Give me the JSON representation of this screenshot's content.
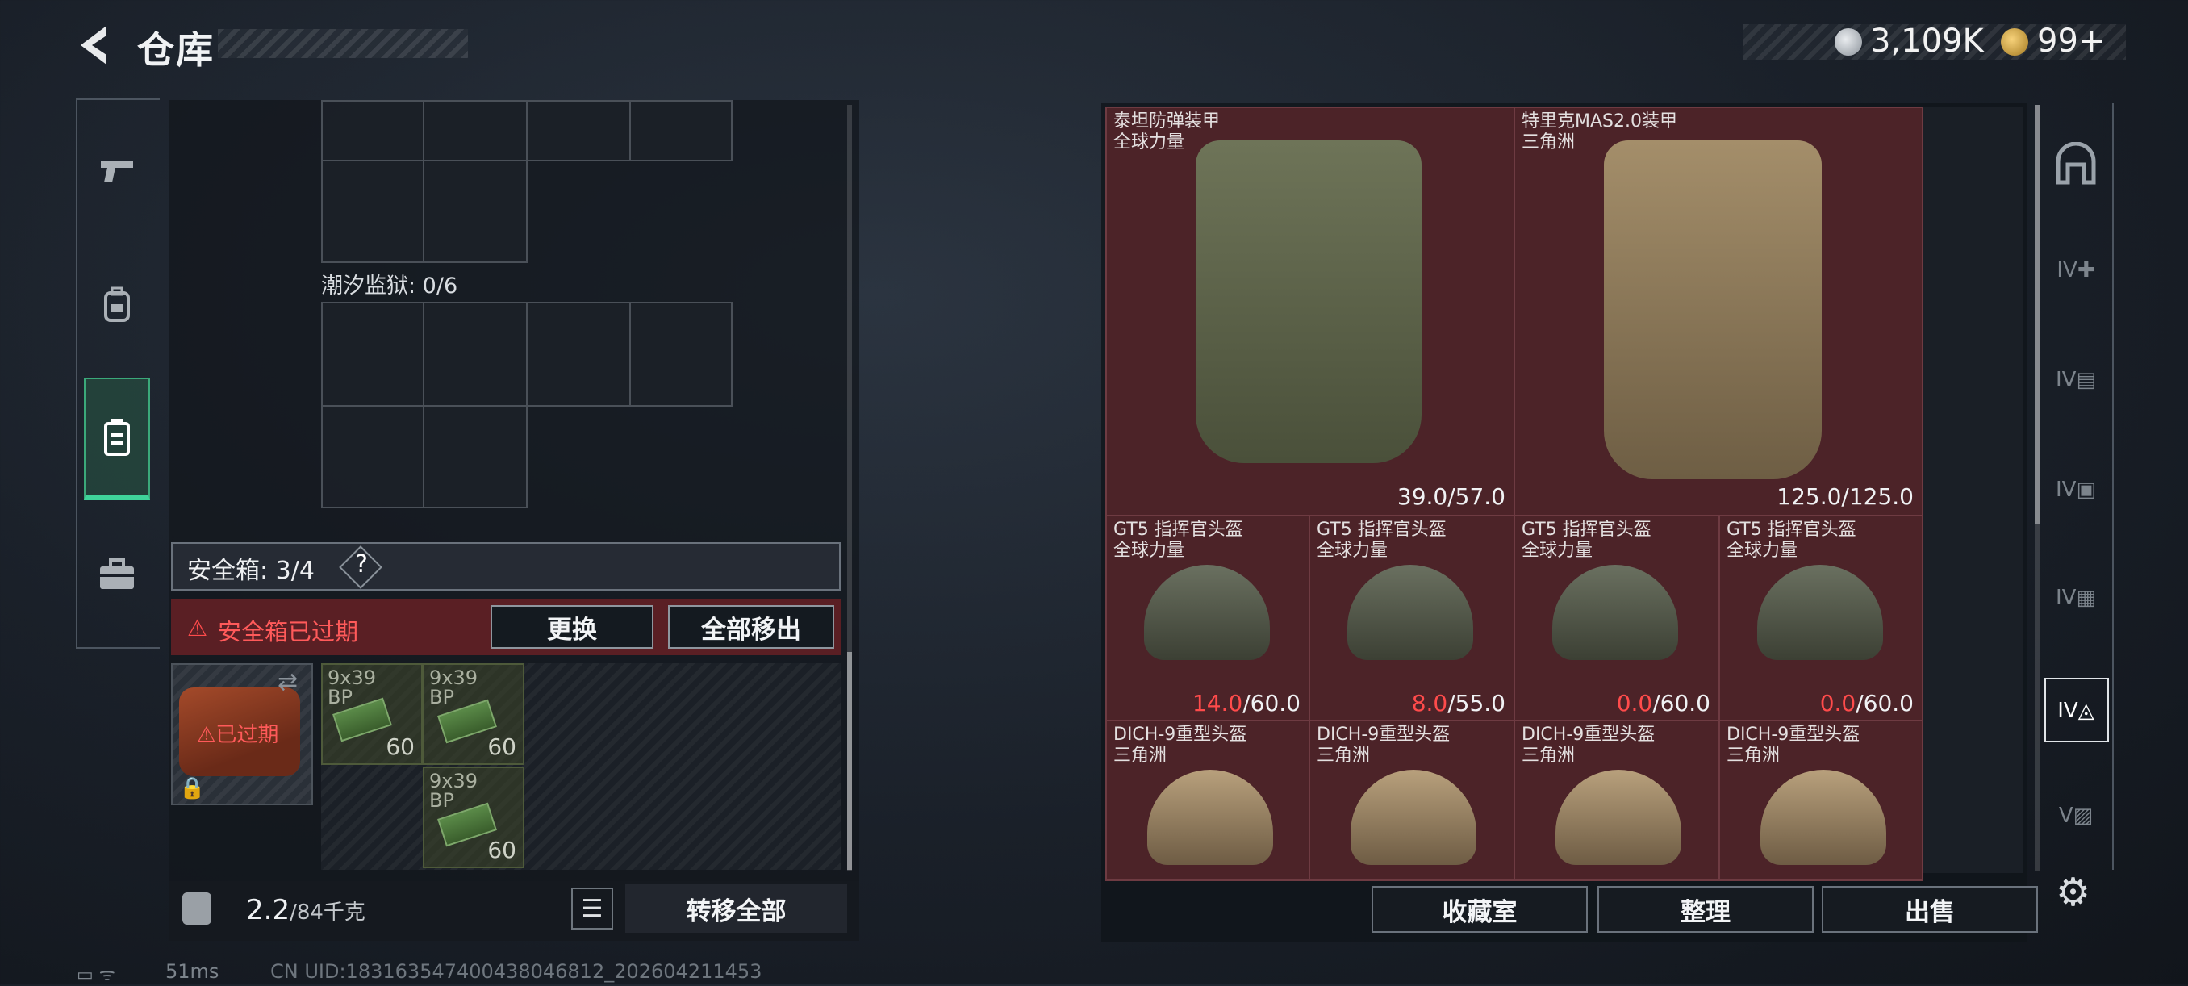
{
  "header": {
    "title": "仓库",
    "currency": "3,109K",
    "premium": "99+"
  },
  "left_panel": {
    "prison_label": "潮汐监狱: 0/6",
    "safe_box_label": "安全箱: 3/4",
    "safe_box_help": "?",
    "expired_text": "安全箱已过期",
    "replace_button": "更换",
    "move_all_button": "全部移出",
    "case_expired_label": "已过期",
    "ammo": [
      {
        "name": "9x39",
        "sub": "BP",
        "count": "60"
      },
      {
        "name": "9x39",
        "sub": "BP",
        "count": "60"
      },
      {
        "name": "9x39",
        "sub": "BP",
        "count": "60"
      }
    ],
    "weight_value": "2.2",
    "weight_capacity": "/84千克",
    "transfer_all_button": "转移全部"
  },
  "status": {
    "ping": "51ms",
    "uid": "CN UID:18316354740043804681​2_202604211453"
  },
  "items": {
    "vests": [
      {
        "name": "泰坦防弹装甲",
        "faction": "全球力量",
        "durability": "39.0/57.0"
      },
      {
        "name": "特里克MAS2.0装甲",
        "faction": "三角洲",
        "durability": "125.0/125.0"
      }
    ],
    "helmets_gt5": [
      {
        "name": "GT5 指挥官头盔",
        "faction": "全球力量",
        "current": "14.0",
        "max": "/60.0"
      },
      {
        "name": "GT5 指挥官头盔",
        "faction": "全球力量",
        "current": "8.0",
        "max": "/55.0"
      },
      {
        "name": "GT5 指挥官头盔",
        "faction": "全球力量",
        "current": "0.0",
        "max": "/60.0"
      },
      {
        "name": "GT5 指挥官头盔",
        "faction": "全球力量",
        "current": "0.0",
        "max": "/60.0"
      }
    ],
    "helmets_dich": [
      {
        "name": "DICH-9重型头盔",
        "faction": "三角洲"
      },
      {
        "name": "DICH-9重型头盔",
        "faction": "三角洲"
      },
      {
        "name": "DICH-9重型头盔",
        "faction": "三角洲"
      },
      {
        "name": "DICH-9重型头盔",
        "faction": "三角洲"
      }
    ]
  },
  "bottom_buttons": {
    "collection": "收藏室",
    "organize": "整理",
    "sell": "出售"
  },
  "right_nav": {
    "labels": [
      "IV",
      "IV",
      "IV",
      "IV",
      "IV",
      "V"
    ]
  },
  "colors": {
    "item_bg": "#4c2328",
    "warning_red": "#ff4b4b",
    "accent_green": "#3fd49a"
  }
}
